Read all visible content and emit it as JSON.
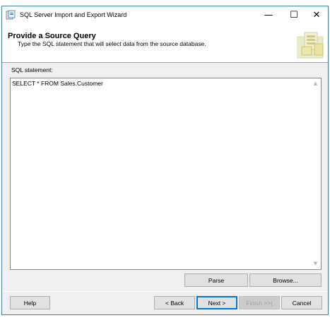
{
  "window": {
    "title": "SQL Server Import and Export Wizard",
    "minimize_glyph": "—",
    "maximize_glyph": "☐",
    "close_glyph": "✕"
  },
  "header": {
    "title": "Provide a Source Query",
    "subtitle": "Type the SQL statement that will select data from the source database."
  },
  "sql": {
    "label": "SQL statement:",
    "value": "SELECT * FROM Sales.Customer"
  },
  "buttons": {
    "parse": "Parse",
    "browse": "Browse...",
    "help": "Help",
    "back": "< Back",
    "next": "Next >",
    "finish": "Finish >>|",
    "cancel": "Cancel"
  },
  "icons": {
    "app": "wizard-app-icon",
    "header": "wizard-header-graphic",
    "scroll_up": "scroll-up-arrow-icon",
    "scroll_down": "scroll-down-arrow-icon"
  },
  "colors": {
    "window_border": "#3c7fb1",
    "dialog_bg": "#f0f0f0",
    "button_bg": "#e1e1e1",
    "default_button_border": "#0078d7"
  }
}
